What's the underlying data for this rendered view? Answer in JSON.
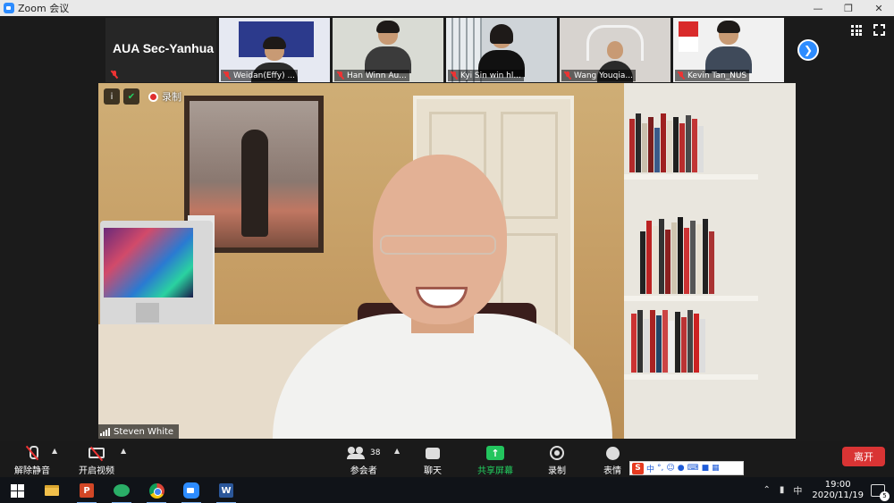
{
  "window": {
    "title": "Zoom 会议",
    "controls": [
      "—",
      "▭",
      "❐",
      "✕"
    ]
  },
  "gallery": {
    "host_tile_name": "AUA Sec-Yanhua",
    "tiles": [
      {
        "label": "Weidan(Effy) ...",
        "shirt": "#2b2b2b",
        "bg": "#e6e9f2"
      },
      {
        "label": "Han Winn Au...",
        "shirt": "#3b3b3b",
        "bg": "#d9dbd4"
      },
      {
        "label": "Kyi Sin win hl...",
        "shirt": "#111111",
        "bg": "#cfd4d8"
      },
      {
        "label": "Wang Youqia...",
        "shirt": "#2a2a2a",
        "bg": "#d7d3cf"
      },
      {
        "label": "Kevin Tan_NUS",
        "shirt": "#3f4a5a",
        "bg": "#f1f1f1"
      }
    ],
    "next_icon": "chevron-right-icon"
  },
  "main_video": {
    "speaker_name": "Steven White",
    "recording_label": "录制"
  },
  "toolbar": {
    "unmute_label": "解除静音",
    "start_video_label": "开启视频",
    "participants_label": "参会者",
    "participants_count": "38",
    "chat_label": "聊天",
    "share_label": "共享屏幕",
    "record_label": "录制",
    "reactions_label": "表情",
    "leave_label": "离开",
    "ime_text": "中"
  },
  "taskbar": {
    "apps": [
      "windows-start",
      "file-explorer",
      "powerpoint",
      "wechat",
      "chrome",
      "zoom",
      "word"
    ],
    "tray_lang": "中",
    "time": "19:00",
    "date": "2020/11/19",
    "notification_count": "5"
  },
  "colors": {
    "zoom_blue": "#2d8cff",
    "share_green": "#23c55e",
    "leave_red": "#d93434",
    "muted_red": "#e33333"
  }
}
